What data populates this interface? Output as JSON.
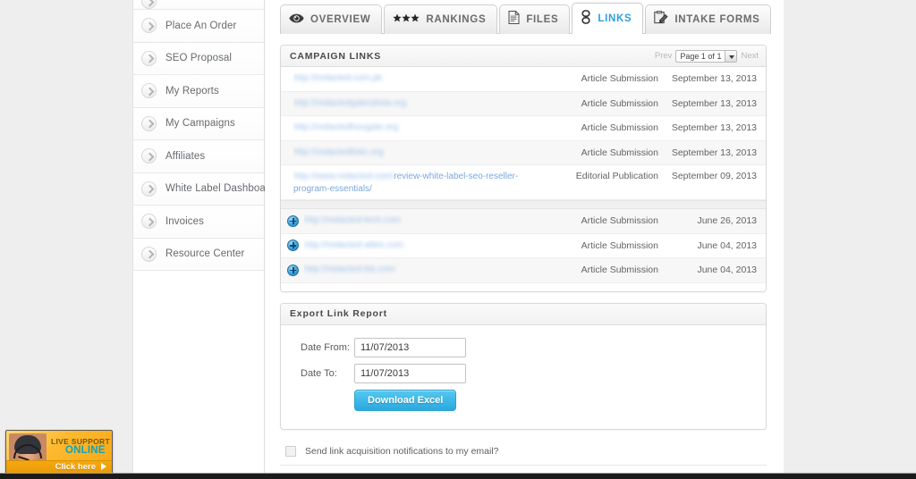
{
  "sidebar": {
    "items": [
      {
        "label": "",
        "partial": true
      },
      {
        "label": "Place An Order"
      },
      {
        "label": "SEO Proposal"
      },
      {
        "label": "My Reports"
      },
      {
        "label": "My Campaigns"
      },
      {
        "label": "Affiliates"
      },
      {
        "label": "White Label Dashboard"
      },
      {
        "label": "Invoices"
      },
      {
        "label": "Resource Center"
      }
    ]
  },
  "tabs": [
    {
      "label": "OVERVIEW",
      "icon": "eye-icon",
      "active": false
    },
    {
      "label": "RANKINGS",
      "icon": "stars-icon",
      "active": false
    },
    {
      "label": "FILES",
      "icon": "document-icon",
      "active": false
    },
    {
      "label": "LINKS",
      "icon": "chain-link-icon",
      "active": true
    },
    {
      "label": "INTAKE FORMS",
      "icon": "clipboard-pen-icon",
      "active": false
    }
  ],
  "campaign_links": {
    "title": "CAMPAIGN LINKS",
    "pager": {
      "prev": "Prev",
      "next": "Next",
      "page_value": "Page 1 of 1"
    },
    "rows": [
      {
        "url_blurred": "http://redacted.com.pk",
        "url_visible": "",
        "type": "Article Submission",
        "date": "September 13, 2013",
        "expandable": false,
        "alt": false
      },
      {
        "url_blurred": "http://redactedgalerylista.org",
        "url_visible": "",
        "type": "Article Submission",
        "date": "September 13, 2013",
        "expandable": false,
        "alt": true
      },
      {
        "url_blurred": "http://redactedhougate.org",
        "url_visible": "",
        "type": "Article Submission",
        "date": "September 13, 2013",
        "expandable": false,
        "alt": false
      },
      {
        "url_blurred": "http://redactedlistic.org",
        "url_visible": "",
        "type": "Article Submission",
        "date": "September 13, 2013",
        "expandable": false,
        "alt": true
      },
      {
        "url_blurred": "http://www.redacted.com/",
        "url_visible": "review-white-label-seo-reseller-program-essentials/",
        "type": "Editorial Publication",
        "date": "September 09, 2013",
        "expandable": false,
        "alt": false,
        "tall": true
      }
    ],
    "rows_expandable": [
      {
        "url_blurred": "http://redacted-tech.com",
        "url_visible": "",
        "type": "Article Submission",
        "date": "June 26, 2013",
        "expandable": true,
        "alt": true
      },
      {
        "url_blurred": "http://redacted-attire.com",
        "url_visible": "",
        "type": "Article Submission",
        "date": "June 04, 2013",
        "expandable": true,
        "alt": false
      },
      {
        "url_blurred": "http://redacted-biz.com",
        "url_visible": "",
        "type": "Article Submission",
        "date": "June 04, 2013",
        "expandable": true,
        "alt": true
      }
    ]
  },
  "export": {
    "title": "Export Link Report",
    "date_from_label": "Date From:",
    "date_from_value": "11/07/2013",
    "date_to_label": "Date To:",
    "date_to_value": "11/07/2013",
    "download_label": "Download Excel"
  },
  "notify": {
    "label": "Send link acquisition notifications to my email?",
    "checked": false
  },
  "support_widget": {
    "line1": "LIVE SUPPORT",
    "line2": "ONLINE",
    "cta": "Click here"
  },
  "colors": {
    "accent_blue": "#29a9e0",
    "active_tab_text": "#2e9fe0",
    "link_blue": "#7aa8de",
    "page_bg": "#eeeeee",
    "support_orange": "#f7a615"
  }
}
